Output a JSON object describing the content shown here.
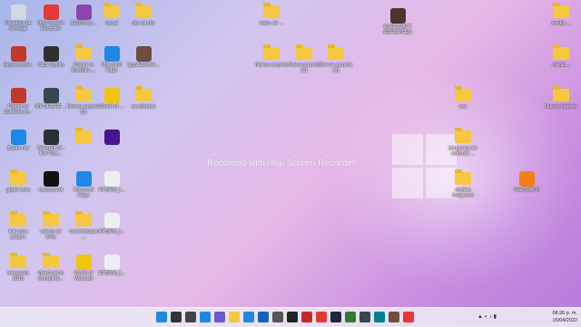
{
  "watermark": "Recorded with iTop Screen Recorder",
  "icons": [
    {
      "label": "Papelera de reciclaje",
      "kind": "app",
      "color": "#cfd8e3"
    },
    {
      "label": "iTop Screen Recorder",
      "kind": "app",
      "color": "#e53935"
    },
    {
      "label": "122900 pr...",
      "kind": "app",
      "color": "#8e44ad"
    },
    {
      "label": "visual",
      "kind": "folder"
    },
    {
      "label": "obs studio",
      "kind": "folder"
    },
    {
      "label": "ilegorecortar.",
      "kind": "app",
      "color": "#c0392b"
    },
    {
      "label": "OBS Studio",
      "kind": "app",
      "color": "#303030"
    },
    {
      "label": "Plants vs Zombies ...",
      "kind": "folder"
    },
    {
      "label": "Microsoft Edge",
      "kind": "app",
      "color": "#1e88e5"
    },
    {
      "label": "appxEZOrde...",
      "kind": "app",
      "color": "#6d4c41"
    },
    {
      "label": "Plants vs Zombies in...",
      "kind": "app",
      "color": "#c0392b"
    },
    {
      "label": "Wii ORCHE ...",
      "kind": "app",
      "color": "#37474f"
    },
    {
      "label": "Nueva carpeta (3)",
      "kind": "folder"
    },
    {
      "label": "World of ...",
      "kind": "app",
      "color": "#f1c40f"
    },
    {
      "label": "sevolidado",
      "kind": "folder"
    },
    {
      "label": "Battle.net",
      "kind": "app",
      "color": "#1e88e5"
    },
    {
      "label": "Warcraft III - the Froz...",
      "kind": "app",
      "color": "#263238"
    },
    {
      "label": "",
      "kind": "folder"
    },
    {
      "label": "",
      "kind": "app",
      "color": "#4a148c"
    },
    {
      "label": "glade wow",
      "kind": "folder"
    },
    {
      "label": "esessment",
      "kind": "app",
      "color": "#111"
    },
    {
      "label": "Microsoft Edge",
      "kind": "app",
      "color": "#1e88e5"
    },
    {
      "label": "RPBRM_I...",
      "kind": "app",
      "color": "#eceff1"
    },
    {
      "label": "link para juegos",
      "kind": "folder"
    },
    {
      "label": "videos de kelly",
      "kind": "folder"
    },
    {
      "label": "comerbloque ...",
      "kind": "folder"
    },
    {
      "label": "RPBRM_I...",
      "kind": "app",
      "color": "#eceff1"
    },
    {
      "label": "Interpreta 2018",
      "kind": "folder"
    },
    {
      "label": "WarCraft III Complete...",
      "kind": "folder"
    },
    {
      "label": "World of Warcraft",
      "kind": "app",
      "color": "#f1c40f"
    },
    {
      "label": "RPBRM_I...",
      "kind": "app",
      "color": "#eceff1"
    },
    {
      "label": "video de ...",
      "kind": "folder"
    },
    {
      "label": "WARCRAFT REFORGED",
      "kind": "app",
      "color": "#4e342e"
    },
    {
      "label": "media ...",
      "kind": "folder"
    },
    {
      "label": "Nueva carpeta",
      "kind": "folder"
    },
    {
      "label": "Nueva carpeta (2)",
      "kind": "folder"
    },
    {
      "label": "Nueva carpeta (4)",
      "kind": "folder"
    },
    {
      "label": "media...",
      "kind": "folder"
    },
    {
      "label": "war",
      "kind": "folder"
    },
    {
      "label": "Nueva carpeta",
      "kind": "folder"
    },
    {
      "label": "imagenes de warcraft ...",
      "kind": "folder"
    },
    {
      "label": "medias imagenes",
      "kind": "folder"
    },
    {
      "label": "WarCraft III",
      "kind": "app",
      "color": "#f57f17"
    }
  ],
  "taskbar": {
    "apps": [
      {
        "name": "start-icon",
        "color": "#1e88e5"
      },
      {
        "name": "search-icon",
        "color": "#333"
      },
      {
        "name": "task-view-icon",
        "color": "#444"
      },
      {
        "name": "widgets-icon",
        "color": "#1e88e5"
      },
      {
        "name": "chat-icon",
        "color": "#6a5acd"
      },
      {
        "name": "file-explorer-icon",
        "color": "#f5c842"
      },
      {
        "name": "edge-icon",
        "color": "#1e88e5"
      },
      {
        "name": "store-icon",
        "color": "#1565c0"
      },
      {
        "name": "settings-icon",
        "color": "#555"
      },
      {
        "name": "obs-icon",
        "color": "#222"
      },
      {
        "name": "app-icon",
        "color": "#c62828"
      },
      {
        "name": "recorder-icon",
        "color": "#e53935"
      },
      {
        "name": "steam-icon",
        "color": "#1b2838"
      },
      {
        "name": "app-icon-2",
        "color": "#2e7d32"
      },
      {
        "name": "app-icon-3",
        "color": "#37474f"
      },
      {
        "name": "app-icon-4",
        "color": "#00838f"
      },
      {
        "name": "app-icon-5",
        "color": "#6d4c41"
      },
      {
        "name": "youtube-icon",
        "color": "#e53935"
      }
    ],
    "time": "08:26 p. m.",
    "date": "15/04/2022"
  }
}
